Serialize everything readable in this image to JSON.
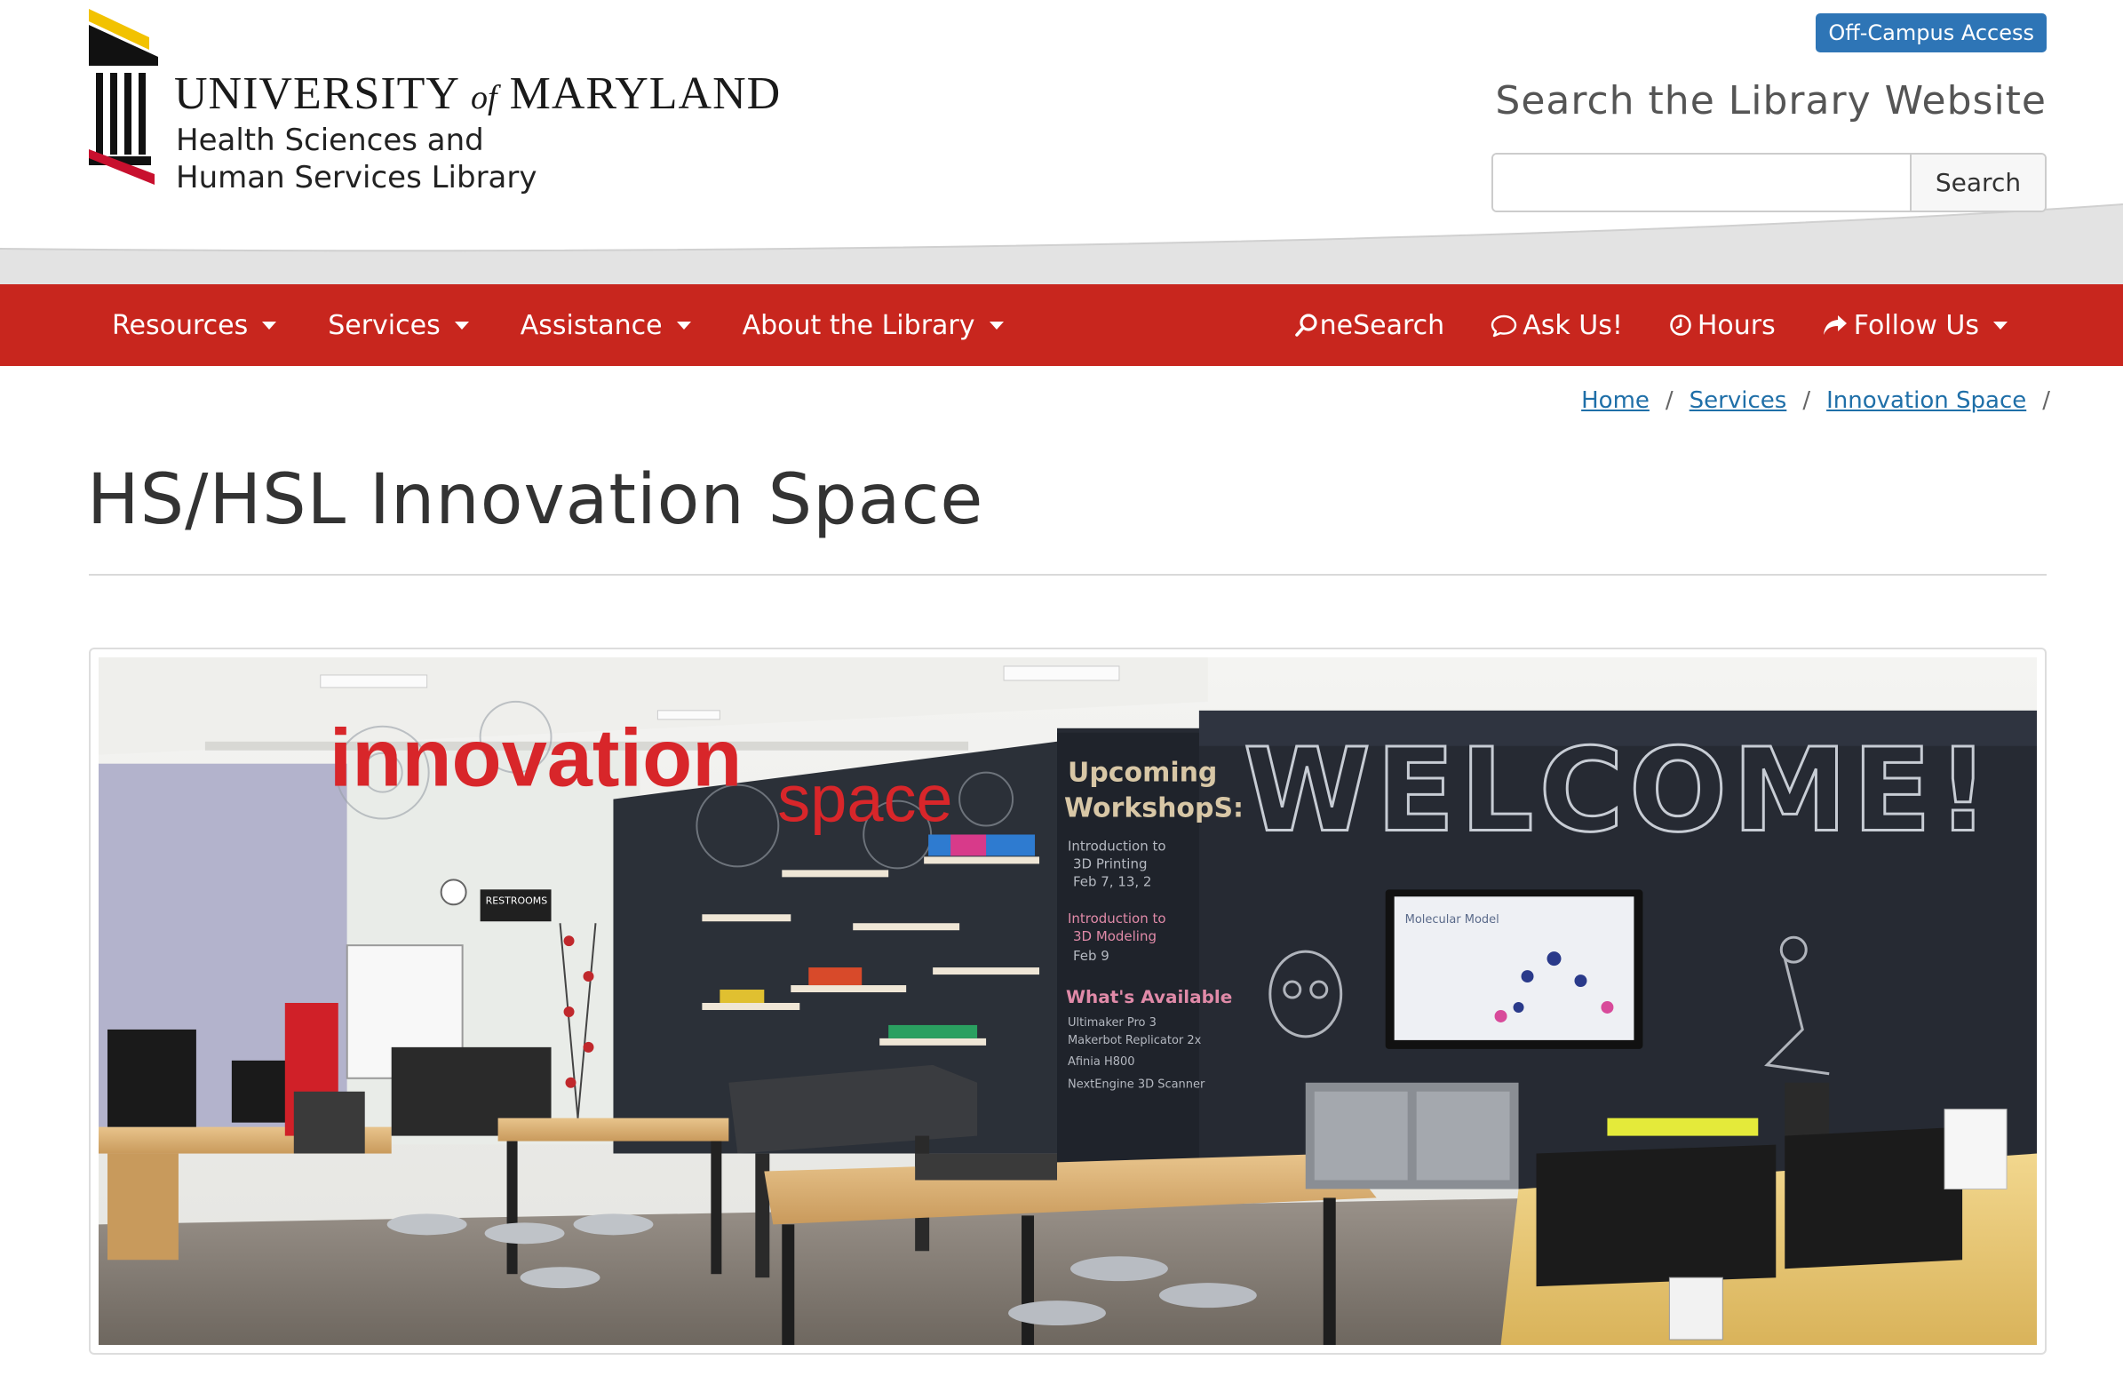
{
  "header": {
    "logo": {
      "university_word": "UNIVERSITY",
      "of_word": "of",
      "maryland_word": "MARYLAND",
      "subtitle_line1": "Health Sciences and",
      "subtitle_line2": "Human Services Library"
    },
    "offcampus_label": "Off-Campus Access",
    "search": {
      "title": "Search the Library Website",
      "placeholder": "",
      "value": "",
      "button_label": "Search"
    }
  },
  "nav": {
    "left": [
      {
        "label": "Resources"
      },
      {
        "label": "Services"
      },
      {
        "label": "Assistance"
      },
      {
        "label": "About the Library"
      }
    ],
    "right": [
      {
        "label": "neSearch",
        "icon": "search-icon"
      },
      {
        "label": "Ask Us!",
        "icon": "chat-icon"
      },
      {
        "label": "Hours",
        "icon": "clock-icon"
      },
      {
        "label": "Follow Us",
        "icon": "share-icon"
      }
    ]
  },
  "breadcrumb": [
    {
      "label": "Home"
    },
    {
      "label": "Services"
    },
    {
      "label": "Innovation Space"
    }
  ],
  "breadcrumb_separator": "/",
  "page": {
    "title": "HS/HSL Innovation Space"
  },
  "photo": {
    "sign_word1": "innovation",
    "sign_word2": "space",
    "wall_text": "WELCOME!",
    "board_heading_line1": "Upcoming",
    "board_heading_line2": "WorkshopS:",
    "board_item1": "Introduction to",
    "board_item1b": "3D Printing",
    "board_item1c": "Feb 7, 13, 2",
    "board_item2": "Introduction to",
    "board_item2b": "3D Modeling",
    "board_item2c": "Feb 9",
    "board_heading2": "What's Available",
    "board_list1": "Ultimaker Pro 3",
    "board_list2": "Makerbot Replicator 2x",
    "board_list3": "Afinia H800",
    "board_list4": "NextEngine 3D Scanner",
    "restrooms_sign": "RESTROOMS",
    "tv_caption": "Molecular Model"
  },
  "colors": {
    "nav_red": "#c8261e",
    "offcampus_blue": "#2e75b6",
    "link_blue": "#1f6fa8",
    "logo_gold": "#f2c200",
    "logo_red": "#c8102e"
  }
}
